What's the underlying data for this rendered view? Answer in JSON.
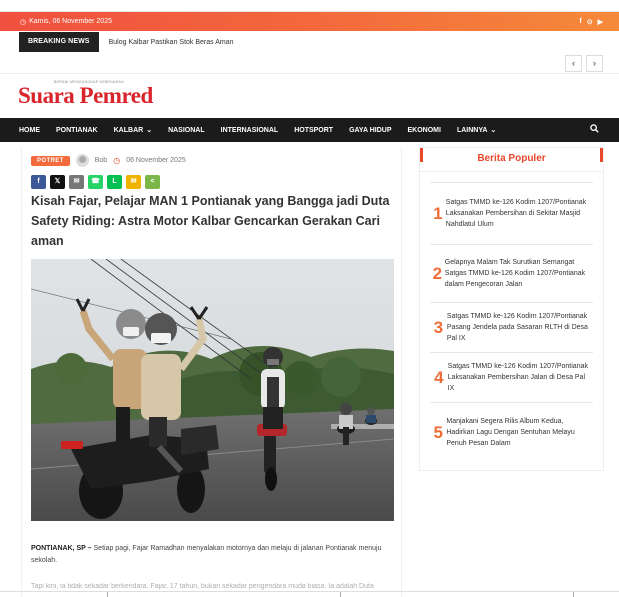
{
  "topbar": {
    "date": "Kamis, 06 November 2025",
    "socials": [
      "f",
      "⊙",
      "▶"
    ]
  },
  "breaking": {
    "label": "BREAKING NEWS",
    "headline": "Bulog Kalbar Pastikan Stok Beras Aman"
  },
  "nav_arrows": {
    "prev": "‹",
    "next": "›"
  },
  "logo": {
    "tagline": "BERANI MENGUNGKAP KEBENARAN",
    "name": "Suara Pemred"
  },
  "nav": {
    "items": [
      {
        "label": "HOME",
        "dropdown": false
      },
      {
        "label": "PONTIANAK",
        "dropdown": false
      },
      {
        "label": "KALBAR",
        "dropdown": true
      },
      {
        "label": "NASIONAL",
        "dropdown": false
      },
      {
        "label": "INTERNASIONAL",
        "dropdown": false
      },
      {
        "label": "HOTSPORT",
        "dropdown": false
      },
      {
        "label": "GAYA HIDUP",
        "dropdown": false
      },
      {
        "label": "EKONOMI",
        "dropdown": false
      },
      {
        "label": "LAINNYA",
        "dropdown": true
      }
    ],
    "search_icon": "search-icon"
  },
  "article": {
    "category": "POTRET",
    "author": "Bob",
    "date": "06 November 2025",
    "title": "Kisah Fajar, Pelajar MAN 1 Pontianak yang Bangga jadi Duta Safety Riding: Astra Motor Kalbar Gencarkan Gerakan Cari aman",
    "share_buttons": [
      {
        "name": "facebook",
        "glyph": "f",
        "color": "#3b5998"
      },
      {
        "name": "x",
        "glyph": "𝕏",
        "color": "#111111"
      },
      {
        "name": "email",
        "glyph": "✉",
        "color": "#777777"
      },
      {
        "name": "whatsapp",
        "glyph": "☎",
        "color": "#25d366"
      },
      {
        "name": "line",
        "glyph": "L",
        "color": "#06c152"
      },
      {
        "name": "sms",
        "glyph": "✉",
        "color": "#f0b400"
      },
      {
        "name": "sharethis",
        "glyph": "<",
        "color": "#7ab648"
      }
    ],
    "dateline": "PONTIANAK, SP –",
    "lead": " Setiap pagi, Fajar Ramadhan menyalakan motornya dan melaju di jalanan Pontianak menuju sekolah.",
    "next_line": "Tapi kini, ia tidak sekadar berkendara. Fajar, 17 tahun, bukan sekadar pengendara muda biasa. Ia adalah Duta"
  },
  "sidebar": {
    "title": "Berita Populer",
    "items": [
      {
        "num": "1",
        "text": "Satgas TMMD ke-126 Kodim 1207/Pontianak Laksanakan Pembersihan di Sekitar Masjid Nahdlatul Ulum"
      },
      {
        "num": "2",
        "text": "Gelapnya Malam Tak Surutkan Semangat Satgas TMMD ke-126 Kodim 1207/Pontianak dalam Pengecoran Jalan"
      },
      {
        "num": "3",
        "text": "Satgas TMMD ke-126 Kodim 1207/Pontianak Pasang Jendela pada Sasaran RLTH di Desa Pal IX"
      },
      {
        "num": "4",
        "text": "Satgas TMMD ke-126 Kodim 1207/Pontianak Laksanakan Pembersihan Jalan di Desa Pal IX"
      },
      {
        "num": "5",
        "text": "Manjakani Segera Rilis Album Kedua, Hadirkan Lagu Dengan Sentuhan Melayu Penuh Pesan Dalam"
      }
    ]
  },
  "colors": {
    "accent": "#e8472c",
    "orange": "#f36a3c",
    "nav_bg": "#1b1b1b",
    "logo_red": "#d8242a"
  }
}
